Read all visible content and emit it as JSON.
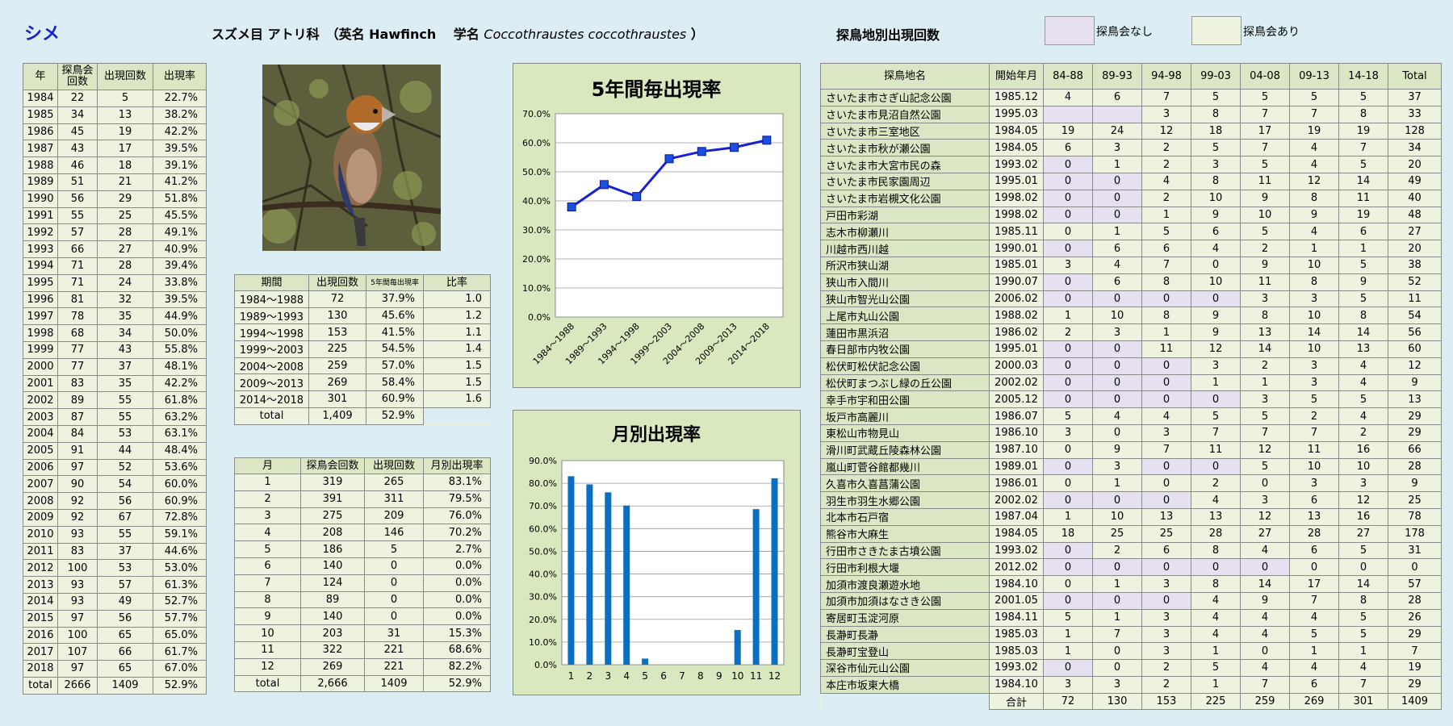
{
  "header": {
    "species": "シメ",
    "classification": "スズメ目 アトリ科　（英名 Hawfinch　 学名",
    "scientific": "Coccothraustes coccothraustes",
    "close_paren": "）",
    "location_title": "探鳥地別出現回数",
    "legend_none": "探鳥会なし",
    "legend_some": "探鳥会あり"
  },
  "colors": {
    "no_meeting": "#e6e0f0",
    "meeting": "#eef3df",
    "line": "#1a1fd6",
    "bar": "#0a6fc2",
    "panel": "#d9e8bf"
  },
  "yearly": {
    "headers": [
      "年",
      "探鳥会回数",
      "出現回数",
      "出現率"
    ],
    "rows": [
      [
        "1984",
        "22",
        "5",
        "22.7%"
      ],
      [
        "1985",
        "34",
        "13",
        "38.2%"
      ],
      [
        "1986",
        "45",
        "19",
        "42.2%"
      ],
      [
        "1987",
        "43",
        "17",
        "39.5%"
      ],
      [
        "1988",
        "46",
        "18",
        "39.1%"
      ],
      [
        "1989",
        "51",
        "21",
        "41.2%"
      ],
      [
        "1990",
        "56",
        "29",
        "51.8%"
      ],
      [
        "1991",
        "55",
        "25",
        "45.5%"
      ],
      [
        "1992",
        "57",
        "28",
        "49.1%"
      ],
      [
        "1993",
        "66",
        "27",
        "40.9%"
      ],
      [
        "1994",
        "71",
        "28",
        "39.4%"
      ],
      [
        "1995",
        "71",
        "24",
        "33.8%"
      ],
      [
        "1996",
        "81",
        "32",
        "39.5%"
      ],
      [
        "1997",
        "78",
        "35",
        "44.9%"
      ],
      [
        "1998",
        "68",
        "34",
        "50.0%"
      ],
      [
        "1999",
        "77",
        "43",
        "55.8%"
      ],
      [
        "2000",
        "77",
        "37",
        "48.1%"
      ],
      [
        "2001",
        "83",
        "35",
        "42.2%"
      ],
      [
        "2002",
        "89",
        "55",
        "61.8%"
      ],
      [
        "2003",
        "87",
        "55",
        "63.2%"
      ],
      [
        "2004",
        "84",
        "53",
        "63.1%"
      ],
      [
        "2005",
        "91",
        "44",
        "48.4%"
      ],
      [
        "2006",
        "97",
        "52",
        "53.6%"
      ],
      [
        "2007",
        "90",
        "54",
        "60.0%"
      ],
      [
        "2008",
        "92",
        "56",
        "60.9%"
      ],
      [
        "2009",
        "92",
        "67",
        "72.8%"
      ],
      [
        "2010",
        "93",
        "55",
        "59.1%"
      ],
      [
        "2011",
        "83",
        "37",
        "44.6%"
      ],
      [
        "2012",
        "100",
        "53",
        "53.0%"
      ],
      [
        "2013",
        "93",
        "57",
        "61.3%"
      ],
      [
        "2014",
        "93",
        "49",
        "52.7%"
      ],
      [
        "2015",
        "97",
        "56",
        "57.7%"
      ],
      [
        "2016",
        "100",
        "65",
        "65.0%"
      ],
      [
        "2017",
        "107",
        "66",
        "61.7%"
      ],
      [
        "2018",
        "97",
        "65",
        "67.0%"
      ],
      [
        "total",
        "2666",
        "1409",
        "52.9%"
      ]
    ]
  },
  "period": {
    "headers": [
      "期間",
      "出現回数",
      "5年間毎出現率",
      "比率"
    ],
    "rows": [
      [
        "1984～1988",
        "72",
        "37.9%",
        "1.0"
      ],
      [
        "1989～1993",
        "130",
        "45.6%",
        "1.2"
      ],
      [
        "1994～1998",
        "153",
        "41.5%",
        "1.1"
      ],
      [
        "1999～2003",
        "225",
        "54.5%",
        "1.4"
      ],
      [
        "2004～2008",
        "259",
        "57.0%",
        "1.5"
      ],
      [
        "2009～2013",
        "269",
        "58.4%",
        "1.5"
      ],
      [
        "2014～2018",
        "301",
        "60.9%",
        "1.6"
      ]
    ],
    "total": [
      "total",
      "1,409",
      "52.9%"
    ]
  },
  "monthly": {
    "headers": [
      "月",
      "探鳥会回数",
      "出現回数",
      "月別出現率"
    ],
    "rows": [
      [
        "1",
        "319",
        "265",
        "83.1%"
      ],
      [
        "2",
        "391",
        "311",
        "79.5%"
      ],
      [
        "3",
        "275",
        "209",
        "76.0%"
      ],
      [
        "4",
        "208",
        "146",
        "70.2%"
      ],
      [
        "5",
        "186",
        "5",
        "2.7%"
      ],
      [
        "6",
        "140",
        "0",
        "0.0%"
      ],
      [
        "7",
        "124",
        "0",
        "0.0%"
      ],
      [
        "8",
        "89",
        "0",
        "0.0%"
      ],
      [
        "9",
        "140",
        "0",
        "0.0%"
      ],
      [
        "10",
        "203",
        "31",
        "15.3%"
      ],
      [
        "11",
        "322",
        "221",
        "68.6%"
      ],
      [
        "12",
        "269",
        "221",
        "82.2%"
      ],
      [
        "total",
        "2,666",
        "1409",
        "52.9%"
      ]
    ]
  },
  "locations": {
    "headers": [
      "探鳥地名",
      "開始年月",
      "84-88",
      "89-93",
      "94-98",
      "99-03",
      "04-08",
      "09-13",
      "14-18",
      "Total"
    ],
    "rows": [
      {
        "cells": [
          "さいたま市さぎ山記念公園",
          "1985.12",
          "4",
          "6",
          "7",
          "5",
          "5",
          "5",
          "5",
          "37"
        ],
        "none": []
      },
      {
        "cells": [
          "さいたま市見沼自然公園",
          "1995.03",
          "",
          "",
          "3",
          "8",
          "7",
          "7",
          "8",
          "33"
        ],
        "none": [
          2,
          3
        ]
      },
      {
        "cells": [
          "さいたま市三室地区",
          "1984.05",
          "19",
          "24",
          "12",
          "18",
          "17",
          "19",
          "19",
          "128"
        ],
        "none": []
      },
      {
        "cells": [
          "さいたま市秋が瀬公園",
          "1984.05",
          "6",
          "3",
          "2",
          "5",
          "7",
          "4",
          "7",
          "34"
        ],
        "none": []
      },
      {
        "cells": [
          "さいたま市大宮市民の森",
          "1993.02",
          "0",
          "1",
          "2",
          "3",
          "5",
          "4",
          "5",
          "20"
        ],
        "none": [
          2
        ]
      },
      {
        "cells": [
          "さいたま市民家園周辺",
          "1995.01",
          "0",
          "0",
          "4",
          "8",
          "11",
          "12",
          "14",
          "49"
        ],
        "none": [
          2,
          3
        ]
      },
      {
        "cells": [
          "さいたま市岩槻文化公園",
          "1998.02",
          "0",
          "0",
          "2",
          "10",
          "9",
          "8",
          "11",
          "40"
        ],
        "none": [
          2,
          3
        ]
      },
      {
        "cells": [
          "戸田市彩湖",
          "1998.02",
          "0",
          "0",
          "1",
          "9",
          "10",
          "9",
          "19",
          "48"
        ],
        "none": [
          2,
          3
        ]
      },
      {
        "cells": [
          "志木市柳瀬川",
          "1985.11",
          "0",
          "1",
          "5",
          "6",
          "5",
          "4",
          "6",
          "27"
        ],
        "none": []
      },
      {
        "cells": [
          "川越市西川越",
          "1990.01",
          "0",
          "6",
          "6",
          "4",
          "2",
          "1",
          "1",
          "20"
        ],
        "none": [
          2
        ]
      },
      {
        "cells": [
          "所沢市狭山湖",
          "1985.01",
          "3",
          "4",
          "7",
          "0",
          "9",
          "10",
          "5",
          "38"
        ],
        "none": []
      },
      {
        "cells": [
          "狭山市入間川",
          "1990.07",
          "0",
          "6",
          "8",
          "10",
          "11",
          "8",
          "9",
          "52"
        ],
        "none": [
          2
        ]
      },
      {
        "cells": [
          "狭山市智光山公園",
          "2006.02",
          "0",
          "0",
          "0",
          "0",
          "3",
          "3",
          "5",
          "11"
        ],
        "none": [
          2,
          3,
          4,
          5
        ]
      },
      {
        "cells": [
          "上尾市丸山公園",
          "1988.02",
          "1",
          "10",
          "8",
          "9",
          "8",
          "10",
          "8",
          "54"
        ],
        "none": []
      },
      {
        "cells": [
          "蓮田市黒浜沼",
          "1986.02",
          "2",
          "3",
          "1",
          "9",
          "13",
          "14",
          "14",
          "56"
        ],
        "none": []
      },
      {
        "cells": [
          "春日部市内牧公園",
          "1995.01",
          "0",
          "0",
          "11",
          "12",
          "14",
          "10",
          "13",
          "60"
        ],
        "none": [
          2,
          3
        ]
      },
      {
        "cells": [
          "松伏町松伏記念公園",
          "2000.03",
          "0",
          "0",
          "0",
          "3",
          "2",
          "3",
          "4",
          "12"
        ],
        "none": [
          2,
          3,
          4
        ]
      },
      {
        "cells": [
          "松伏町まつぶし緑の丘公園",
          "2002.02",
          "0",
          "0",
          "0",
          "1",
          "1",
          "3",
          "4",
          "9"
        ],
        "none": [
          2,
          3,
          4
        ]
      },
      {
        "cells": [
          "幸手市宇和田公園",
          "2005.12",
          "0",
          "0",
          "0",
          "0",
          "3",
          "5",
          "5",
          "13"
        ],
        "none": [
          2,
          3,
          4,
          5
        ]
      },
      {
        "cells": [
          "坂戸市高麗川",
          "1986.07",
          "5",
          "4",
          "4",
          "5",
          "5",
          "2",
          "4",
          "29"
        ],
        "none": []
      },
      {
        "cells": [
          "東松山市物見山",
          "1986.10",
          "3",
          "0",
          "3",
          "7",
          "7",
          "7",
          "2",
          "29"
        ],
        "none": []
      },
      {
        "cells": [
          "滑川町武蔵丘陵森林公園",
          "1987.10",
          "0",
          "9",
          "7",
          "11",
          "12",
          "11",
          "16",
          "66"
        ],
        "none": []
      },
      {
        "cells": [
          "嵐山町菅谷館都幾川",
          "1989.01",
          "0",
          "3",
          "0",
          "0",
          "5",
          "10",
          "10",
          "28"
        ],
        "none": [
          2,
          4,
          5
        ]
      },
      {
        "cells": [
          "久喜市久喜菖蒲公園",
          "1986.01",
          "0",
          "1",
          "0",
          "2",
          "0",
          "3",
          "3",
          "9"
        ],
        "none": []
      },
      {
        "cells": [
          "羽生市羽生水郷公園",
          "2002.02",
          "0",
          "0",
          "0",
          "4",
          "3",
          "6",
          "12",
          "25"
        ],
        "none": [
          2,
          3,
          4
        ]
      },
      {
        "cells": [
          "北本市石戸宿",
          "1987.04",
          "1",
          "10",
          "13",
          "13",
          "12",
          "13",
          "16",
          "78"
        ],
        "none": []
      },
      {
        "cells": [
          "熊谷市大麻生",
          "1984.05",
          "18",
          "25",
          "25",
          "28",
          "27",
          "28",
          "27",
          "178"
        ],
        "none": []
      },
      {
        "cells": [
          "行田市さきたま古墳公園",
          "1993.02",
          "0",
          "2",
          "6",
          "8",
          "4",
          "6",
          "5",
          "31"
        ],
        "none": [
          2
        ]
      },
      {
        "cells": [
          "行田市利根大堰",
          "2012.02",
          "0",
          "0",
          "0",
          "0",
          "0",
          "0",
          "0",
          "0"
        ],
        "none": [
          2,
          3,
          4,
          5,
          6
        ]
      },
      {
        "cells": [
          "加須市渡良瀬遊水地",
          "1984.10",
          "0",
          "1",
          "3",
          "8",
          "14",
          "17",
          "14",
          "57"
        ],
        "none": []
      },
      {
        "cells": [
          "加須市加須はなさき公園",
          "2001.05",
          "0",
          "0",
          "0",
          "4",
          "9",
          "7",
          "8",
          "28"
        ],
        "none": [
          2,
          3,
          4
        ]
      },
      {
        "cells": [
          "寄居町玉淀河原",
          "1984.11",
          "5",
          "1",
          "3",
          "4",
          "4",
          "4",
          "5",
          "26"
        ],
        "none": []
      },
      {
        "cells": [
          "長瀞町長瀞",
          "1985.03",
          "1",
          "7",
          "3",
          "4",
          "4",
          "5",
          "5",
          "29"
        ],
        "none": []
      },
      {
        "cells": [
          "長瀞町宝登山",
          "1985.03",
          "1",
          "0",
          "3",
          "1",
          "0",
          "1",
          "1",
          "7"
        ],
        "none": []
      },
      {
        "cells": [
          "深谷市仙元山公園",
          "1993.02",
          "0",
          "0",
          "2",
          "5",
          "4",
          "4",
          "4",
          "19"
        ],
        "none": [
          2
        ]
      },
      {
        "cells": [
          "本庄市坂東大橋",
          "1984.10",
          "3",
          "3",
          "2",
          "1",
          "7",
          "6",
          "7",
          "29"
        ],
        "none": []
      }
    ],
    "total": [
      "合計",
      "72",
      "130",
      "153",
      "225",
      "259",
      "269",
      "301",
      "1409"
    ]
  },
  "chart_data": [
    {
      "type": "line",
      "title": "5年間毎出現率",
      "categories": [
        "1984～1988",
        "1989～1993",
        "1994～1998",
        "1999～2003",
        "2004～2008",
        "2009～2013",
        "2014～2018"
      ],
      "values": [
        37.9,
        45.6,
        41.5,
        54.5,
        57.0,
        58.4,
        60.9
      ],
      "ylim": [
        0,
        70
      ],
      "yticks": [
        "0.0%",
        "10.0%",
        "20.0%",
        "30.0%",
        "40.0%",
        "50.0%",
        "60.0%",
        "70.0%"
      ],
      "grid": true
    },
    {
      "type": "bar",
      "title": "月別出現率",
      "categories": [
        "1",
        "2",
        "3",
        "4",
        "5",
        "6",
        "7",
        "8",
        "9",
        "10",
        "11",
        "12"
      ],
      "values": [
        83.1,
        79.5,
        76.0,
        70.2,
        2.7,
        0.0,
        0.0,
        0.0,
        0.0,
        15.3,
        68.6,
        82.2
      ],
      "ylim": [
        0,
        90
      ],
      "yticks": [
        "0.0%",
        "10.0%",
        "20.0%",
        "30.0%",
        "40.0%",
        "50.0%",
        "60.0%",
        "70.0%",
        "80.0%",
        "90.0%"
      ],
      "grid": true
    }
  ]
}
